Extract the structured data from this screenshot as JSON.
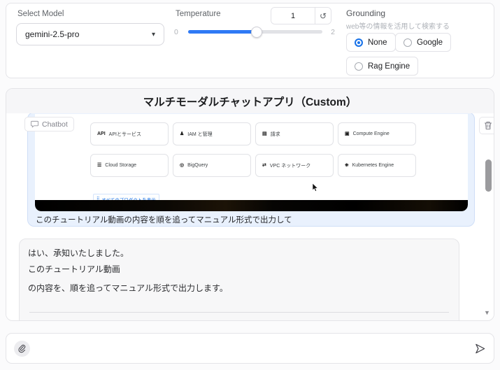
{
  "colors": {
    "accent_blue": "#2f7af5",
    "radio_selected_blue": "#1a73e8",
    "user_bubble_bg": "#e9f1fd",
    "bot_bubble_bg": "#f7f7f8",
    "link_blue": "#1a73e8"
  },
  "controls": {
    "model": {
      "label": "Select Model",
      "value": "gemini-2.5-pro",
      "caret_icon": "▾"
    },
    "temperature": {
      "label": "Temperature",
      "value": "1",
      "min_label": "0",
      "max_label": "2",
      "reset_icon": "↺"
    },
    "grounding": {
      "label": "Grounding",
      "description": "web等の情報を活用して検索する",
      "options": [
        {
          "label": "None",
          "selected": true
        },
        {
          "label": "Google",
          "selected": false
        },
        {
          "label": "Rag Engine",
          "selected": false
        }
      ]
    }
  },
  "header": {
    "title": "マルチモーダルチャットアプリ（Custom）"
  },
  "chatbot": {
    "label": "Chatbot",
    "scroll_down_icon": "▼",
    "user_message": {
      "text": "このチュートリアル動画の内容を順を追ってマニュアル形式で出力して",
      "video_frame": {
        "cards": [
          {
            "icon": "API",
            "label": "APIとサービス"
          },
          {
            "icon": "♟",
            "label": "IAM と管理"
          },
          {
            "icon": "▤",
            "label": "請求"
          },
          {
            "icon": "▣",
            "label": "Compute Engine"
          },
          {
            "icon": "☰",
            "label": "Cloud Storage"
          },
          {
            "icon": "◎",
            "label": "BigQuery"
          },
          {
            "icon": "⇄",
            "label": "VPC ネットワーク"
          },
          {
            "icon": "⎈",
            "label": "Kubernetes Engine"
          }
        ],
        "products_link": {
          "icon": "⣿",
          "label": "すべてのプロダクトを表示"
        }
      }
    },
    "bot_message": {
      "lines": [
        "はい、承知いたしました。",
        "このチュートリアル動画",
        "の内容を、順を追ってマニュアル形式で出力します。"
      ]
    }
  },
  "composer": {
    "placeholder": ""
  }
}
